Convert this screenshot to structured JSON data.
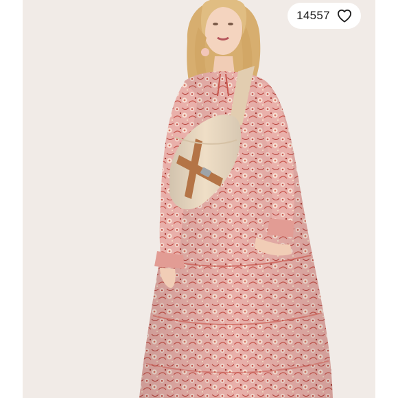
{
  "listing_photo": {
    "icon": "product-photo",
    "subject": "model-in-floral-maxi-dress"
  },
  "like_badge": {
    "count": "14557",
    "icon": "heart-outline-icon"
  },
  "colors": {
    "background": "#ffffff",
    "backdrop": "#f1ebe7",
    "dress_pink": "#e8a9a4",
    "dress_red": "#c8564d",
    "bag_beige": "#eedcc3",
    "strap_brown": "#b47446",
    "hair_blonde": "#d9b274"
  }
}
